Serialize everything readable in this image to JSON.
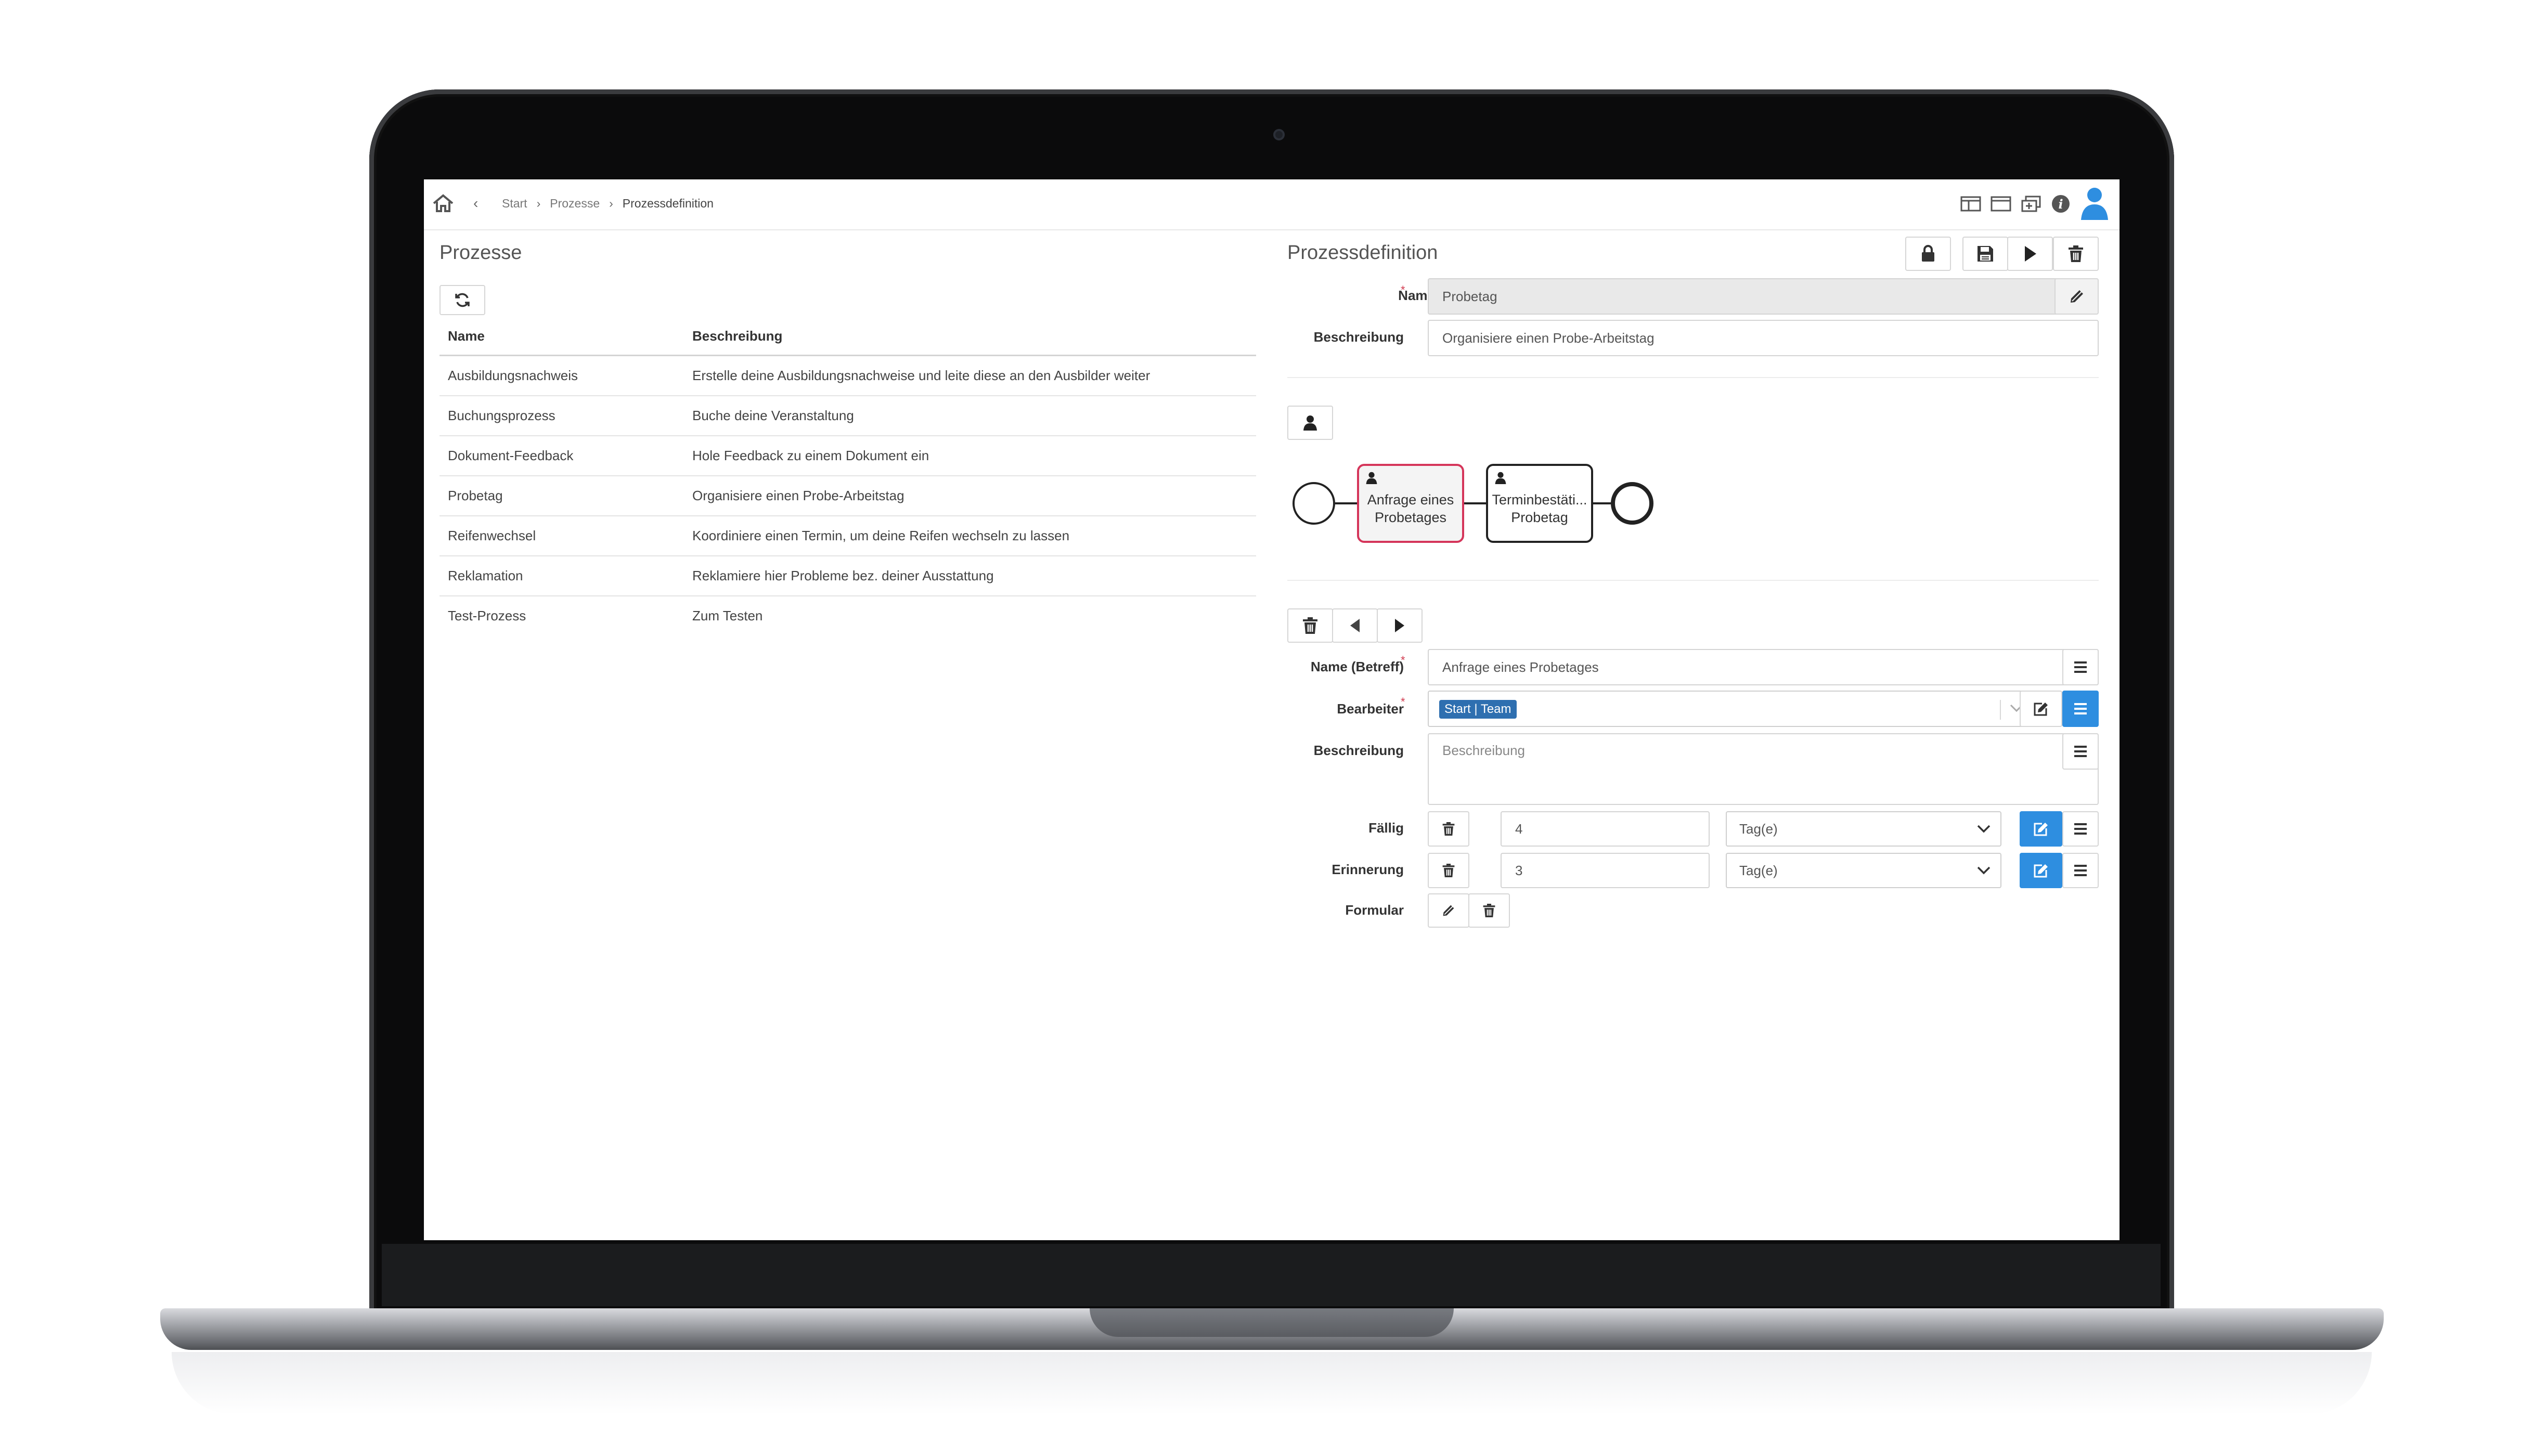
{
  "breadcrumb": {
    "items": [
      "Start",
      "Prozesse",
      "Prozessdefinition"
    ]
  },
  "left": {
    "title": "Prozesse",
    "columns": {
      "name": "Name",
      "description": "Beschreibung"
    },
    "rows": [
      {
        "name": "Ausbildungsnachweis",
        "description": "Erstelle deine Ausbildungsnachweise und leite diese an den Ausbilder weiter"
      },
      {
        "name": "Buchungsprozess",
        "description": "Buche deine Veranstaltung"
      },
      {
        "name": "Dokument-Feedback",
        "description": "Hole Feedback zu einem Dokument ein"
      },
      {
        "name": "Probetag",
        "description": "Organisiere einen Probe-Arbeitstag"
      },
      {
        "name": "Reifenwechsel",
        "description": "Koordiniere einen Termin, um deine Reifen wechseln zu lassen"
      },
      {
        "name": "Reklamation",
        "description": "Reklamiere hier Probleme bez. deiner Ausstattung"
      },
      {
        "name": "Test-Prozess",
        "description": "Zum Testen"
      }
    ]
  },
  "right": {
    "title": "Prozessdefinition",
    "name_label": "Name",
    "name_value": "Probetag",
    "desc_label": "Beschreibung",
    "desc_value": "Organisiere einen Probe-Arbeitstag",
    "diagram": {
      "tasks": [
        {
          "line1": "Anfrage eines",
          "line2": "Probetages"
        },
        {
          "line1": "Terminbestäti...",
          "line2": "Probetag"
        }
      ]
    },
    "task_form": {
      "subject_label": "Name (Betreff)",
      "subject_value": "Anfrage eines Probetages",
      "assignee_label": "Bearbeiter",
      "assignee_tag": "Start | Team",
      "desc_label": "Beschreibung",
      "desc_placeholder": "Beschreibung",
      "due_label": "Fällig",
      "due_value": "4",
      "due_unit": "Tag(e)",
      "reminder_label": "Erinnerung",
      "reminder_value": "3",
      "reminder_unit": "Tag(e)",
      "form_label": "Formular"
    }
  },
  "colors": {
    "accent": "#2e8ee0",
    "selected_task_border": "#d5355a",
    "required": "#d23b4f"
  }
}
